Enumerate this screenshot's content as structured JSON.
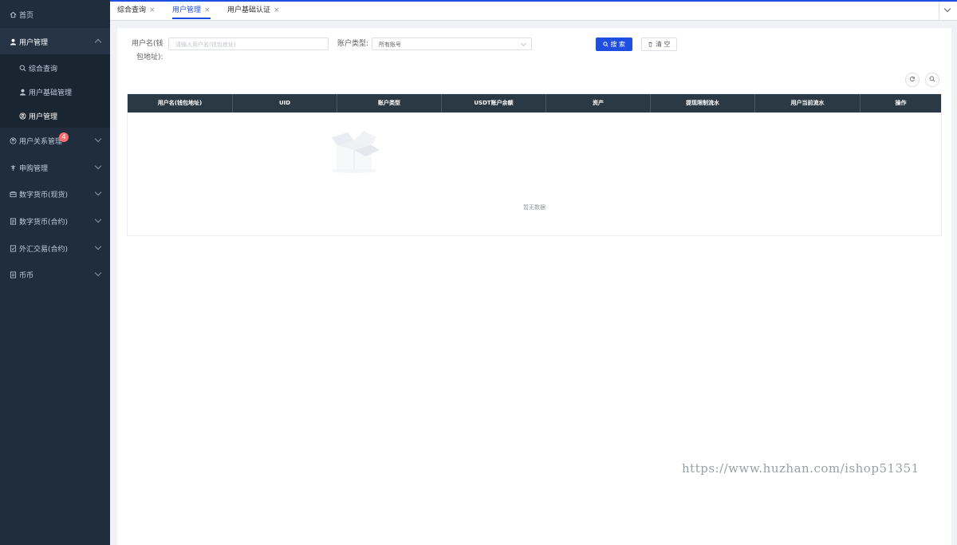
{
  "sidebar": {
    "items": [
      {
        "label": "首页",
        "icon": "home-icon"
      },
      {
        "label": "用户管理",
        "icon": "user-icon"
      },
      {
        "label": "综合查询",
        "icon": "search-icon"
      },
      {
        "label": "用户基础管理",
        "icon": "user-icon"
      },
      {
        "label": "用户管理",
        "icon": "user-circle-icon"
      },
      {
        "label": "用户关系管理",
        "icon": "relation-icon",
        "badge": "4"
      },
      {
        "label": "申购管理",
        "icon": "subscribe-icon"
      },
      {
        "label": "数字货币(现货)",
        "icon": "spot-icon"
      },
      {
        "label": "数字货币(合约)",
        "icon": "contract-icon"
      },
      {
        "label": "外汇交易(合约)",
        "icon": "forex-icon"
      },
      {
        "label": "币币",
        "icon": "coin-icon"
      }
    ]
  },
  "tabs": [
    {
      "label": "综合查询",
      "close": "×"
    },
    {
      "label": "用户管理",
      "close": "×"
    },
    {
      "label": "用户基础认证",
      "close": "×"
    }
  ],
  "form": {
    "username_label_1": "用户名(钱",
    "username_label_2": "包地址):",
    "username_placeholder": "请输入用户名(钱包地址)",
    "account_type_label": "账户类型:",
    "account_type_value": "所有账号",
    "search_button": "搜 索",
    "clear_button": "清 空"
  },
  "table": {
    "columns": [
      "用户名(钱包地址)",
      "UID",
      "账户类型",
      "USDT账户余额",
      "资产",
      "提现限制流水",
      "用户当前流水",
      "操作"
    ],
    "empty_text": "暂无数据"
  },
  "watermark": "https://www.huzhan.com/ishop51351",
  "colors": {
    "accent": "#1e4fe0",
    "sidebar": "#1f2d3d",
    "table_header": "#2b3944"
  }
}
